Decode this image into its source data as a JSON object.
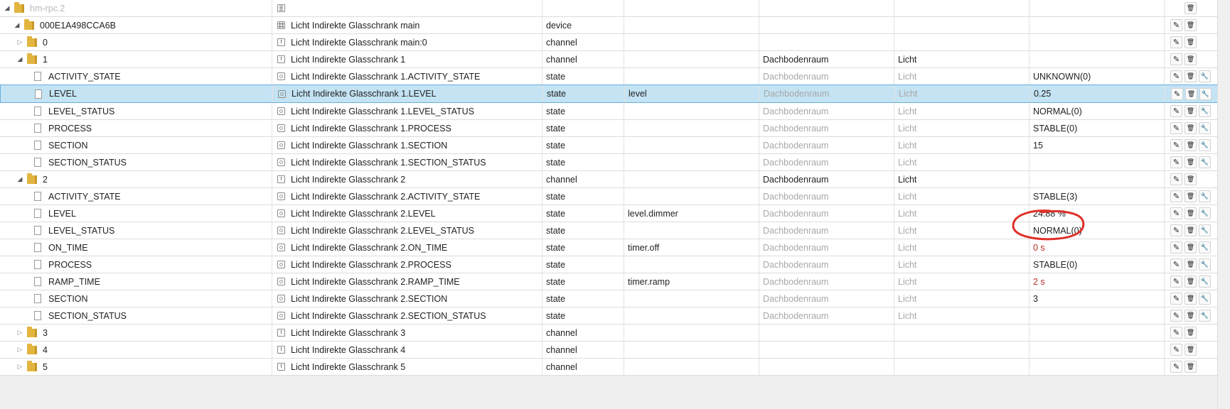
{
  "rows": [
    {
      "indent": 0,
      "arrow": "open",
      "kind": "folder",
      "id": "hm-rpc.2",
      "id_muted": true,
      "ntype": "adapter",
      "name": "",
      "type": "",
      "role": "",
      "room": "",
      "func": "",
      "value": "",
      "value_style": "",
      "room_muted": false,
      "func_muted": false,
      "buttons": [
        "delete"
      ],
      "selected": false
    },
    {
      "indent": 1,
      "arrow": "open",
      "kind": "folder",
      "id": "000E1A498CCA6B",
      "ntype": "device",
      "name": "Licht Indirekte Glasschrank main",
      "type": "device",
      "role": "",
      "room": "",
      "func": "",
      "value": "",
      "value_style": "",
      "room_muted": false,
      "func_muted": false,
      "buttons": [
        "edit",
        "delete"
      ],
      "selected": false
    },
    {
      "indent": 2,
      "arrow": "closed",
      "kind": "folder",
      "id": "0",
      "ntype": "channel",
      "name": "Licht Indirekte Glasschrank main:0",
      "type": "channel",
      "role": "",
      "room": "",
      "func": "",
      "value": "",
      "value_style": "",
      "room_muted": false,
      "func_muted": false,
      "buttons": [
        "edit",
        "delete"
      ],
      "selected": false
    },
    {
      "indent": 2,
      "arrow": "open",
      "kind": "folder",
      "id": "1",
      "ntype": "channel",
      "name": "Licht Indirekte Glasschrank 1",
      "type": "channel",
      "role": "",
      "room": "Dachbodenraum",
      "func": "Licht",
      "value": "",
      "value_style": "",
      "room_muted": false,
      "func_muted": false,
      "buttons": [
        "edit",
        "delete"
      ],
      "selected": false
    },
    {
      "indent": 3,
      "arrow": "none",
      "kind": "doc",
      "id": "ACTIVITY_STATE",
      "ntype": "state",
      "name": "Licht Indirekte Glasschrank 1.ACTIVITY_STATE",
      "type": "state",
      "role": "",
      "room": "Dachbodenraum",
      "func": "Licht",
      "value": "UNKNOWN(0)",
      "value_style": "",
      "room_muted": true,
      "func_muted": true,
      "buttons": [
        "edit",
        "delete",
        "wrench"
      ],
      "selected": false
    },
    {
      "indent": 3,
      "arrow": "none",
      "kind": "doc",
      "id": "LEVEL",
      "ntype": "state",
      "name": "Licht Indirekte Glasschrank 1.LEVEL",
      "type": "state",
      "role": "level",
      "room": "Dachbodenraum",
      "func": "Licht",
      "value": "0.25",
      "value_style": "",
      "room_muted": true,
      "func_muted": true,
      "buttons": [
        "edit",
        "delete",
        "wrench"
      ],
      "selected": true
    },
    {
      "indent": 3,
      "arrow": "none",
      "kind": "doc",
      "id": "LEVEL_STATUS",
      "ntype": "state",
      "name": "Licht Indirekte Glasschrank 1.LEVEL_STATUS",
      "type": "state",
      "role": "",
      "room": "Dachbodenraum",
      "func": "Licht",
      "value": "NORMAL(0)",
      "value_style": "",
      "room_muted": true,
      "func_muted": true,
      "buttons": [
        "edit",
        "delete",
        "wrench"
      ],
      "selected": false
    },
    {
      "indent": 3,
      "arrow": "none",
      "kind": "doc",
      "id": "PROCESS",
      "ntype": "state",
      "name": "Licht Indirekte Glasschrank 1.PROCESS",
      "type": "state",
      "role": "",
      "room": "Dachbodenraum",
      "func": "Licht",
      "value": "STABLE(0)",
      "value_style": "",
      "room_muted": true,
      "func_muted": true,
      "buttons": [
        "edit",
        "delete",
        "wrench"
      ],
      "selected": false
    },
    {
      "indent": 3,
      "arrow": "none",
      "kind": "doc",
      "id": "SECTION",
      "ntype": "state",
      "name": "Licht Indirekte Glasschrank 1.SECTION",
      "type": "state",
      "role": "",
      "room": "Dachbodenraum",
      "func": "Licht",
      "value": "15",
      "value_style": "",
      "room_muted": true,
      "func_muted": true,
      "buttons": [
        "edit",
        "delete",
        "wrench"
      ],
      "selected": false
    },
    {
      "indent": 3,
      "arrow": "none",
      "kind": "doc",
      "id": "SECTION_STATUS",
      "ntype": "state",
      "name": "Licht Indirekte Glasschrank 1.SECTION_STATUS",
      "type": "state",
      "role": "",
      "room": "Dachbodenraum",
      "func": "Licht",
      "value": "",
      "value_style": "",
      "room_muted": true,
      "func_muted": true,
      "buttons": [
        "edit",
        "delete",
        "wrench"
      ],
      "selected": false
    },
    {
      "indent": 2,
      "arrow": "open",
      "kind": "folder",
      "id": "2",
      "ntype": "channel",
      "name": "Licht Indirekte Glasschrank 2",
      "type": "channel",
      "role": "",
      "room": "Dachbodenraum",
      "func": "Licht",
      "value": "",
      "value_style": "",
      "room_muted": false,
      "func_muted": false,
      "buttons": [
        "edit",
        "delete"
      ],
      "selected": false
    },
    {
      "indent": 3,
      "arrow": "none",
      "kind": "doc",
      "id": "ACTIVITY_STATE",
      "ntype": "state",
      "name": "Licht Indirekte Glasschrank 2.ACTIVITY_STATE",
      "type": "state",
      "role": "",
      "room": "Dachbodenraum",
      "func": "Licht",
      "value": "STABLE(3)",
      "value_style": "",
      "room_muted": true,
      "func_muted": true,
      "buttons": [
        "edit",
        "delete",
        "wrench"
      ],
      "selected": false
    },
    {
      "indent": 3,
      "arrow": "none",
      "kind": "doc",
      "id": "LEVEL",
      "ntype": "state",
      "name": "Licht Indirekte Glasschrank 2.LEVEL",
      "type": "state",
      "role": "level.dimmer",
      "room": "Dachbodenraum",
      "func": "Licht",
      "value": "24.88 %",
      "value_style": "",
      "room_muted": true,
      "func_muted": true,
      "buttons": [
        "edit",
        "delete",
        "wrench"
      ],
      "selected": false
    },
    {
      "indent": 3,
      "arrow": "none",
      "kind": "doc",
      "id": "LEVEL_STATUS",
      "ntype": "state",
      "name": "Licht Indirekte Glasschrank 2.LEVEL_STATUS",
      "type": "state",
      "role": "",
      "room": "Dachbodenraum",
      "func": "Licht",
      "value": "NORMAL(0)",
      "value_style": "",
      "room_muted": true,
      "func_muted": true,
      "buttons": [
        "edit",
        "delete",
        "wrench"
      ],
      "selected": false
    },
    {
      "indent": 3,
      "arrow": "none",
      "kind": "doc",
      "id": "ON_TIME",
      "ntype": "state",
      "name": "Licht Indirekte Glasschrank 2.ON_TIME",
      "type": "state",
      "role": "timer.off",
      "room": "Dachbodenraum",
      "func": "Licht",
      "value": "0 s",
      "value_style": "red",
      "room_muted": true,
      "func_muted": true,
      "buttons": [
        "edit",
        "delete",
        "wrench"
      ],
      "selected": false
    },
    {
      "indent": 3,
      "arrow": "none",
      "kind": "doc",
      "id": "PROCESS",
      "ntype": "state",
      "name": "Licht Indirekte Glasschrank 2.PROCESS",
      "type": "state",
      "role": "",
      "room": "Dachbodenraum",
      "func": "Licht",
      "value": "STABLE(0)",
      "value_style": "",
      "room_muted": true,
      "func_muted": true,
      "buttons": [
        "edit",
        "delete",
        "wrench"
      ],
      "selected": false
    },
    {
      "indent": 3,
      "arrow": "none",
      "kind": "doc",
      "id": "RAMP_TIME",
      "ntype": "state",
      "name": "Licht Indirekte Glasschrank 2.RAMP_TIME",
      "type": "state",
      "role": "timer.ramp",
      "room": "Dachbodenraum",
      "func": "Licht",
      "value": "2 s",
      "value_style": "red",
      "room_muted": true,
      "func_muted": true,
      "buttons": [
        "edit",
        "delete",
        "wrench"
      ],
      "selected": false
    },
    {
      "indent": 3,
      "arrow": "none",
      "kind": "doc",
      "id": "SECTION",
      "ntype": "state",
      "name": "Licht Indirekte Glasschrank 2.SECTION",
      "type": "state",
      "role": "",
      "room": "Dachbodenraum",
      "func": "Licht",
      "value": "3",
      "value_style": "",
      "room_muted": true,
      "func_muted": true,
      "buttons": [
        "edit",
        "delete",
        "wrench"
      ],
      "selected": false
    },
    {
      "indent": 3,
      "arrow": "none",
      "kind": "doc",
      "id": "SECTION_STATUS",
      "ntype": "state",
      "name": "Licht Indirekte Glasschrank 2.SECTION_STATUS",
      "type": "state",
      "role": "",
      "room": "Dachbodenraum",
      "func": "Licht",
      "value": "",
      "value_style": "",
      "room_muted": true,
      "func_muted": true,
      "buttons": [
        "edit",
        "delete",
        "wrench"
      ],
      "selected": false
    },
    {
      "indent": 2,
      "arrow": "closed",
      "kind": "folder",
      "id": "3",
      "ntype": "channel",
      "name": "Licht Indirekte Glasschrank 3",
      "type": "channel",
      "role": "",
      "room": "",
      "func": "",
      "value": "",
      "value_style": "",
      "room_muted": false,
      "func_muted": false,
      "buttons": [
        "edit",
        "delete"
      ],
      "selected": false
    },
    {
      "indent": 2,
      "arrow": "closed",
      "kind": "folder",
      "id": "4",
      "ntype": "channel",
      "name": "Licht Indirekte Glasschrank 4",
      "type": "channel",
      "role": "",
      "room": "",
      "func": "",
      "value": "",
      "value_style": "",
      "room_muted": false,
      "func_muted": false,
      "buttons": [
        "edit",
        "delete"
      ],
      "selected": false
    },
    {
      "indent": 2,
      "arrow": "closed",
      "kind": "folder",
      "id": "5",
      "ntype": "channel",
      "name": "Licht Indirekte Glasschrank 5",
      "type": "channel",
      "role": "",
      "room": "",
      "func": "",
      "value": "",
      "value_style": "",
      "room_muted": false,
      "func_muted": false,
      "buttons": [
        "edit",
        "delete"
      ],
      "selected": false
    }
  ],
  "icons": {
    "edit": "pencil-icon",
    "delete": "trash-icon",
    "wrench": "wrench-icon"
  },
  "colors": {
    "selected_bg": "#c4e3f3",
    "selected_border": "#6aaedc",
    "value_red": "#b5302a",
    "annotation": "#e0302a"
  }
}
